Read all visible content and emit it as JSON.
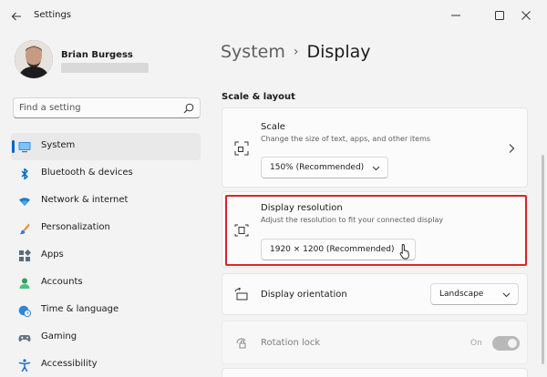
{
  "window": {
    "title": "Settings"
  },
  "user": {
    "name": "Brian Burgess"
  },
  "search": {
    "placeholder": "Find a setting"
  },
  "sidebar": {
    "items": [
      {
        "label": "System",
        "icon": "monitor-icon",
        "active": true
      },
      {
        "label": "Bluetooth & devices",
        "icon": "bluetooth-icon"
      },
      {
        "label": "Network & internet",
        "icon": "wifi-icon"
      },
      {
        "label": "Personalization",
        "icon": "paintbrush-icon"
      },
      {
        "label": "Apps",
        "icon": "apps-grid-icon"
      },
      {
        "label": "Accounts",
        "icon": "person-icon"
      },
      {
        "label": "Time & language",
        "icon": "globe-clock-icon"
      },
      {
        "label": "Gaming",
        "icon": "gamepad-icon"
      },
      {
        "label": "Accessibility",
        "icon": "accessibility-icon"
      }
    ]
  },
  "breadcrumb": {
    "parent": "System",
    "separator": "›",
    "current": "Display"
  },
  "section": {
    "title": "Scale & layout"
  },
  "scale": {
    "title": "Scale",
    "description": "Change the size of text, apps, and other items",
    "value": "150% (Recommended)"
  },
  "resolution": {
    "title": "Display resolution",
    "description": "Adjust the resolution to fit your connected display",
    "value": "1920 × 1200 (Recommended)"
  },
  "orientation": {
    "title": "Display orientation",
    "value": "Landscape"
  },
  "rotation_lock": {
    "title": "Rotation lock",
    "state": "On"
  },
  "colors": {
    "accent": "#0067c0",
    "highlight": "#d9252b"
  }
}
